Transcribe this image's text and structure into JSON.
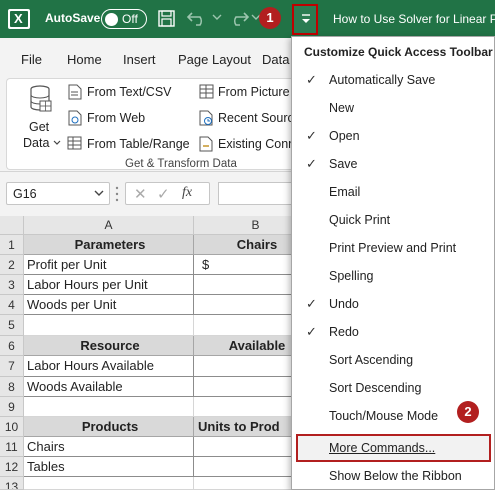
{
  "titlebar": {
    "autosave_label": "AutoSave",
    "autosave_state": "Off",
    "doc_title": "How to Use Solver for Linear Pr",
    "badge_1": "1",
    "bg_color": "#217346"
  },
  "ribbon": {
    "tabs": [
      "File",
      "Home",
      "Insert",
      "Page Layout",
      "Data"
    ],
    "get_data": "Get Data",
    "get_data_line1": "Get",
    "get_data_line2": "Data",
    "from_text_csv": "From Text/CSV",
    "from_web": "From Web",
    "from_table_range": "From Table/Range",
    "from_picture": "From Picture",
    "recent_sources": "Recent Source",
    "existing_connections": "Existing Conn",
    "group_label": "Get & Transform Data"
  },
  "formula_bar": {
    "name_box": "G16",
    "fx": "fx",
    "cancel_glyph": "✕",
    "enter_glyph": "✓",
    "menu_glyph": "⋮"
  },
  "grid": {
    "columns": [
      "A",
      "B"
    ],
    "rows": [
      "1",
      "2",
      "3",
      "4",
      "5",
      "6",
      "7",
      "8",
      "9",
      "10",
      "11",
      "12",
      "13"
    ],
    "a1": "Parameters",
    "b1": "Chairs",
    "a2": "Profit per Unit",
    "b2": "$",
    "a3": "Labor Hours per Unit",
    "a4": "Woods per Unit",
    "a6": "Resource",
    "b6": "Available",
    "a7": "Labor Hours Available",
    "a8": "Woods Available",
    "a10": "Products",
    "b10": "Units to Prod",
    "a11": "Chairs",
    "a12": "Tables"
  },
  "qat_menu": {
    "title": "Customize Quick Access Toolbar",
    "items": [
      {
        "label": "Automatically Save",
        "checked": true
      },
      {
        "label": "New",
        "checked": false
      },
      {
        "label": "Open",
        "checked": true
      },
      {
        "label": "Save",
        "checked": true
      },
      {
        "label": "Email",
        "checked": false
      },
      {
        "label": "Quick Print",
        "checked": false
      },
      {
        "label": "Print Preview and Print",
        "checked": false
      },
      {
        "label": "Spelling",
        "checked": false
      },
      {
        "label": "Undo",
        "checked": true
      },
      {
        "label": "Redo",
        "checked": true
      },
      {
        "label": "Sort Ascending",
        "checked": false
      },
      {
        "label": "Sort Descending",
        "checked": false
      },
      {
        "label": "Touch/Mouse Mode",
        "checked": false
      },
      {
        "label": "More Commands...",
        "checked": false
      },
      {
        "label": "Show Below the Ribbon",
        "checked": false
      }
    ],
    "check_glyph": "✓",
    "badge_2": "2",
    "highlight_color": "#b21f1f"
  }
}
